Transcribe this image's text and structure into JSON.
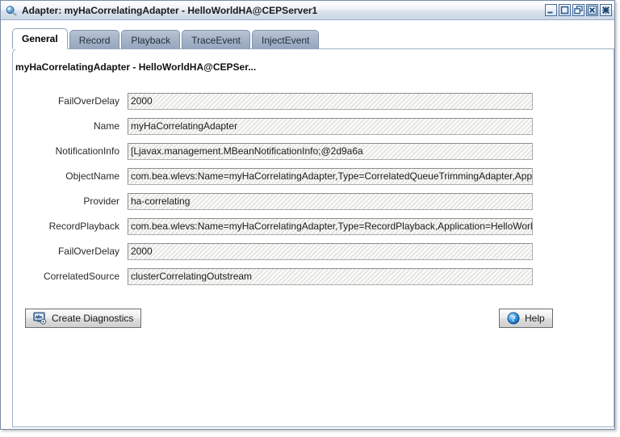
{
  "window": {
    "icon": "blue-sphere-icon",
    "title": "Adapter: myHaCorrelatingAdapter - HelloWorldHA@CEPServer1",
    "controls": [
      {
        "name": "minimize-button",
        "glyph": "minimize"
      },
      {
        "name": "maximize-button",
        "glyph": "maximize"
      },
      {
        "name": "restore-button",
        "glyph": "restore"
      },
      {
        "name": "close-frame-button",
        "glyph": "close-box"
      },
      {
        "name": "close-button",
        "glyph": "close"
      }
    ]
  },
  "tabs": [
    {
      "label": "General",
      "active": true
    },
    {
      "label": "Record",
      "active": false
    },
    {
      "label": "Playback",
      "active": false
    },
    {
      "label": "TraceEvent",
      "active": false
    },
    {
      "label": "InjectEvent",
      "active": false
    }
  ],
  "panel": {
    "heading": "myHaCorrelatingAdapter - HelloWorldHA@CEPSer..."
  },
  "fields": [
    {
      "label": "FailOverDelay",
      "value": "2000"
    },
    {
      "label": "Name",
      "value": "myHaCorrelatingAdapter"
    },
    {
      "label": "NotificationInfo",
      "value": "[Ljavax.management.MBeanNotificationInfo;@2d9a6a"
    },
    {
      "label": "ObjectName",
      "value": "com.bea.wlevs:Name=myHaCorrelatingAdapter,Type=CorrelatedQueueTrimmingAdapter,Application=HelloWorldHA"
    },
    {
      "label": "Provider",
      "value": "ha-correlating"
    },
    {
      "label": "RecordPlayback",
      "value": "com.bea.wlevs:Name=myHaCorrelatingAdapter,Type=RecordPlayback,Application=HelloWorldHA"
    },
    {
      "label": "FailOverDelay",
      "value": "2000"
    },
    {
      "label": "CorrelatedSource",
      "value": "clusterCorrelatingOutstream"
    }
  ],
  "buttons": {
    "create_diagnostics": {
      "label": "Create Diagnostics",
      "icon": "monitor-chart-icon"
    },
    "help": {
      "label": "Help",
      "icon": "question-mark-icon"
    }
  },
  "colors": {
    "titlebar_accent": "#ccd7e6",
    "tab_inactive": "#a5b3c7",
    "panel_border": "#9fb0c6",
    "field_bg": "#eeeeea",
    "help_blue": "#1e6bb8"
  }
}
